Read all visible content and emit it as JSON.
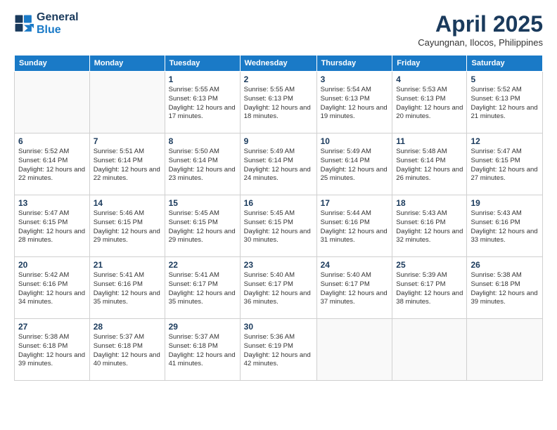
{
  "header": {
    "logo_line1": "General",
    "logo_line2": "Blue",
    "month_title": "April 2025",
    "subtitle": "Cayungnan, Ilocos, Philippines"
  },
  "weekdays": [
    "Sunday",
    "Monday",
    "Tuesday",
    "Wednesday",
    "Thursday",
    "Friday",
    "Saturday"
  ],
  "weeks": [
    [
      {
        "day": "",
        "detail": ""
      },
      {
        "day": "",
        "detail": ""
      },
      {
        "day": "1",
        "detail": "Sunrise: 5:55 AM\nSunset: 6:13 PM\nDaylight: 12 hours and 17 minutes."
      },
      {
        "day": "2",
        "detail": "Sunrise: 5:55 AM\nSunset: 6:13 PM\nDaylight: 12 hours and 18 minutes."
      },
      {
        "day": "3",
        "detail": "Sunrise: 5:54 AM\nSunset: 6:13 PM\nDaylight: 12 hours and 19 minutes."
      },
      {
        "day": "4",
        "detail": "Sunrise: 5:53 AM\nSunset: 6:13 PM\nDaylight: 12 hours and 20 minutes."
      },
      {
        "day": "5",
        "detail": "Sunrise: 5:52 AM\nSunset: 6:13 PM\nDaylight: 12 hours and 21 minutes."
      }
    ],
    [
      {
        "day": "6",
        "detail": "Sunrise: 5:52 AM\nSunset: 6:14 PM\nDaylight: 12 hours and 22 minutes."
      },
      {
        "day": "7",
        "detail": "Sunrise: 5:51 AM\nSunset: 6:14 PM\nDaylight: 12 hours and 22 minutes."
      },
      {
        "day": "8",
        "detail": "Sunrise: 5:50 AM\nSunset: 6:14 PM\nDaylight: 12 hours and 23 minutes."
      },
      {
        "day": "9",
        "detail": "Sunrise: 5:49 AM\nSunset: 6:14 PM\nDaylight: 12 hours and 24 minutes."
      },
      {
        "day": "10",
        "detail": "Sunrise: 5:49 AM\nSunset: 6:14 PM\nDaylight: 12 hours and 25 minutes."
      },
      {
        "day": "11",
        "detail": "Sunrise: 5:48 AM\nSunset: 6:14 PM\nDaylight: 12 hours and 26 minutes."
      },
      {
        "day": "12",
        "detail": "Sunrise: 5:47 AM\nSunset: 6:15 PM\nDaylight: 12 hours and 27 minutes."
      }
    ],
    [
      {
        "day": "13",
        "detail": "Sunrise: 5:47 AM\nSunset: 6:15 PM\nDaylight: 12 hours and 28 minutes."
      },
      {
        "day": "14",
        "detail": "Sunrise: 5:46 AM\nSunset: 6:15 PM\nDaylight: 12 hours and 29 minutes."
      },
      {
        "day": "15",
        "detail": "Sunrise: 5:45 AM\nSunset: 6:15 PM\nDaylight: 12 hours and 29 minutes."
      },
      {
        "day": "16",
        "detail": "Sunrise: 5:45 AM\nSunset: 6:15 PM\nDaylight: 12 hours and 30 minutes."
      },
      {
        "day": "17",
        "detail": "Sunrise: 5:44 AM\nSunset: 6:16 PM\nDaylight: 12 hours and 31 minutes."
      },
      {
        "day": "18",
        "detail": "Sunrise: 5:43 AM\nSunset: 6:16 PM\nDaylight: 12 hours and 32 minutes."
      },
      {
        "day": "19",
        "detail": "Sunrise: 5:43 AM\nSunset: 6:16 PM\nDaylight: 12 hours and 33 minutes."
      }
    ],
    [
      {
        "day": "20",
        "detail": "Sunrise: 5:42 AM\nSunset: 6:16 PM\nDaylight: 12 hours and 34 minutes."
      },
      {
        "day": "21",
        "detail": "Sunrise: 5:41 AM\nSunset: 6:16 PM\nDaylight: 12 hours and 35 minutes."
      },
      {
        "day": "22",
        "detail": "Sunrise: 5:41 AM\nSunset: 6:17 PM\nDaylight: 12 hours and 35 minutes."
      },
      {
        "day": "23",
        "detail": "Sunrise: 5:40 AM\nSunset: 6:17 PM\nDaylight: 12 hours and 36 minutes."
      },
      {
        "day": "24",
        "detail": "Sunrise: 5:40 AM\nSunset: 6:17 PM\nDaylight: 12 hours and 37 minutes."
      },
      {
        "day": "25",
        "detail": "Sunrise: 5:39 AM\nSunset: 6:17 PM\nDaylight: 12 hours and 38 minutes."
      },
      {
        "day": "26",
        "detail": "Sunrise: 5:38 AM\nSunset: 6:18 PM\nDaylight: 12 hours and 39 minutes."
      }
    ],
    [
      {
        "day": "27",
        "detail": "Sunrise: 5:38 AM\nSunset: 6:18 PM\nDaylight: 12 hours and 39 minutes."
      },
      {
        "day": "28",
        "detail": "Sunrise: 5:37 AM\nSunset: 6:18 PM\nDaylight: 12 hours and 40 minutes."
      },
      {
        "day": "29",
        "detail": "Sunrise: 5:37 AM\nSunset: 6:18 PM\nDaylight: 12 hours and 41 minutes."
      },
      {
        "day": "30",
        "detail": "Sunrise: 5:36 AM\nSunset: 6:19 PM\nDaylight: 12 hours and 42 minutes."
      },
      {
        "day": "",
        "detail": ""
      },
      {
        "day": "",
        "detail": ""
      },
      {
        "day": "",
        "detail": ""
      }
    ]
  ]
}
